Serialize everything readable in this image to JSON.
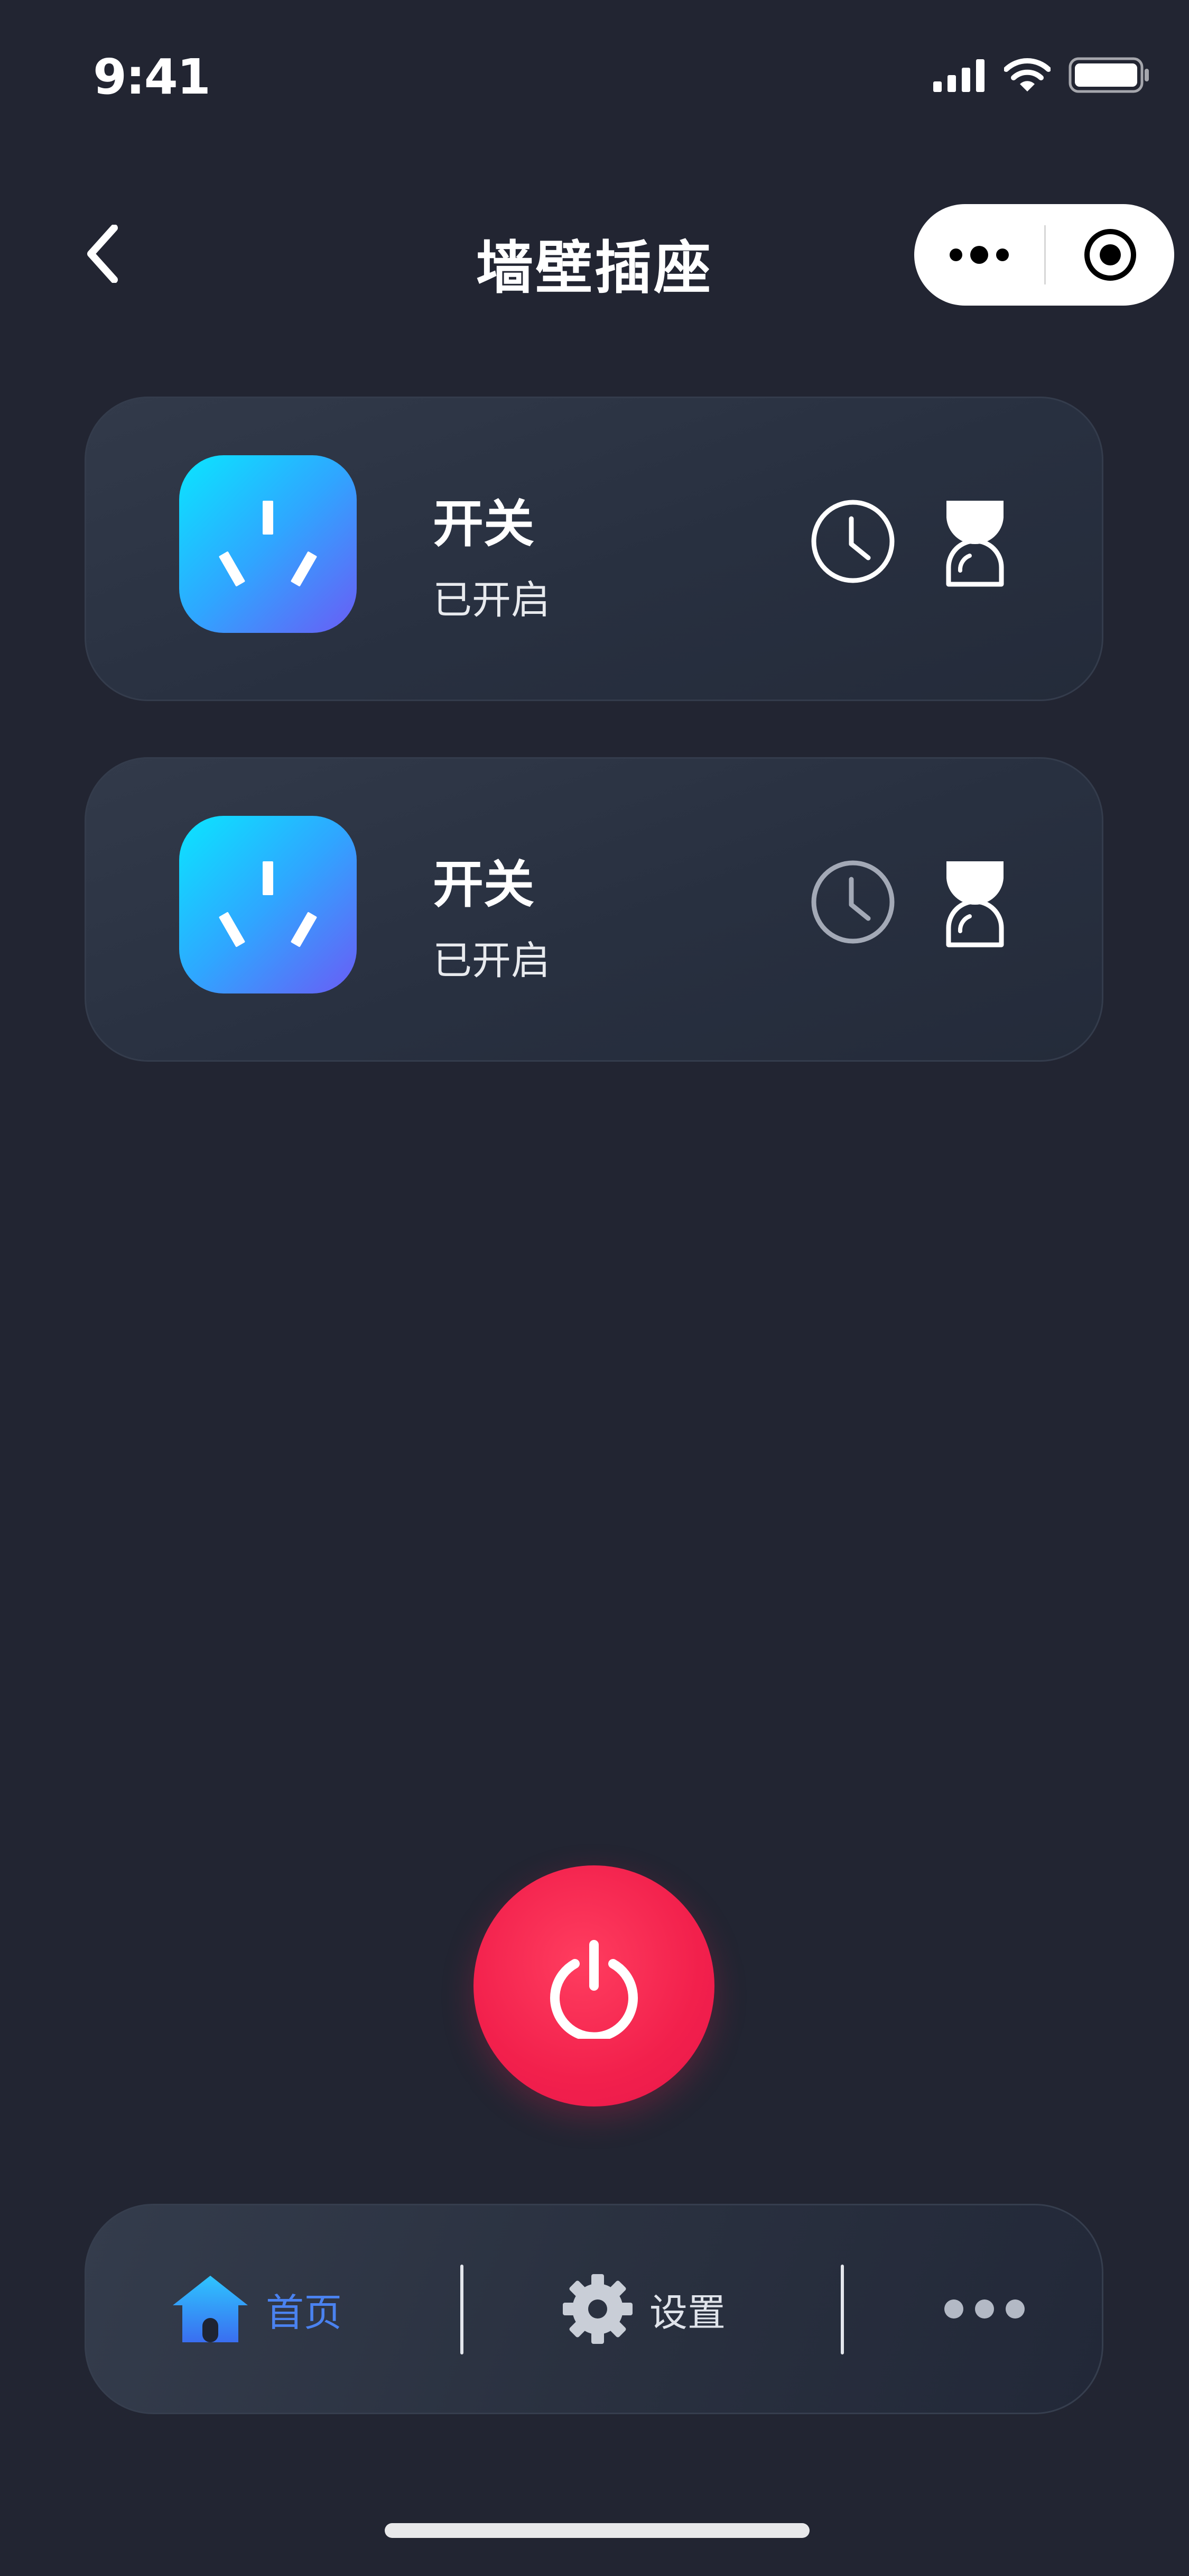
{
  "status_bar": {
    "time": "9:41"
  },
  "nav": {
    "title": "墙壁插座"
  },
  "devices": [
    {
      "title": "开关",
      "status": "已开启"
    },
    {
      "title": "开关",
      "status": "已开启"
    }
  ],
  "tabbar": {
    "home_label": "首页",
    "settings_label": "设置"
  },
  "colors": {
    "background": "#222532",
    "power": "#f2204c",
    "accent": "#4a82f0",
    "tile_gradient": [
      "#0ae6ff",
      "#6a5cf5"
    ]
  },
  "icons": {
    "back": "chevron-left-icon",
    "capsule_more": "more-dots-icon",
    "capsule_close": "target-close-icon",
    "plug": "socket-icon",
    "clock": "clock-icon",
    "timer": "hourglass-icon",
    "power": "power-icon",
    "home": "home-icon",
    "settings": "gear-icon",
    "more": "more-dots-icon"
  }
}
